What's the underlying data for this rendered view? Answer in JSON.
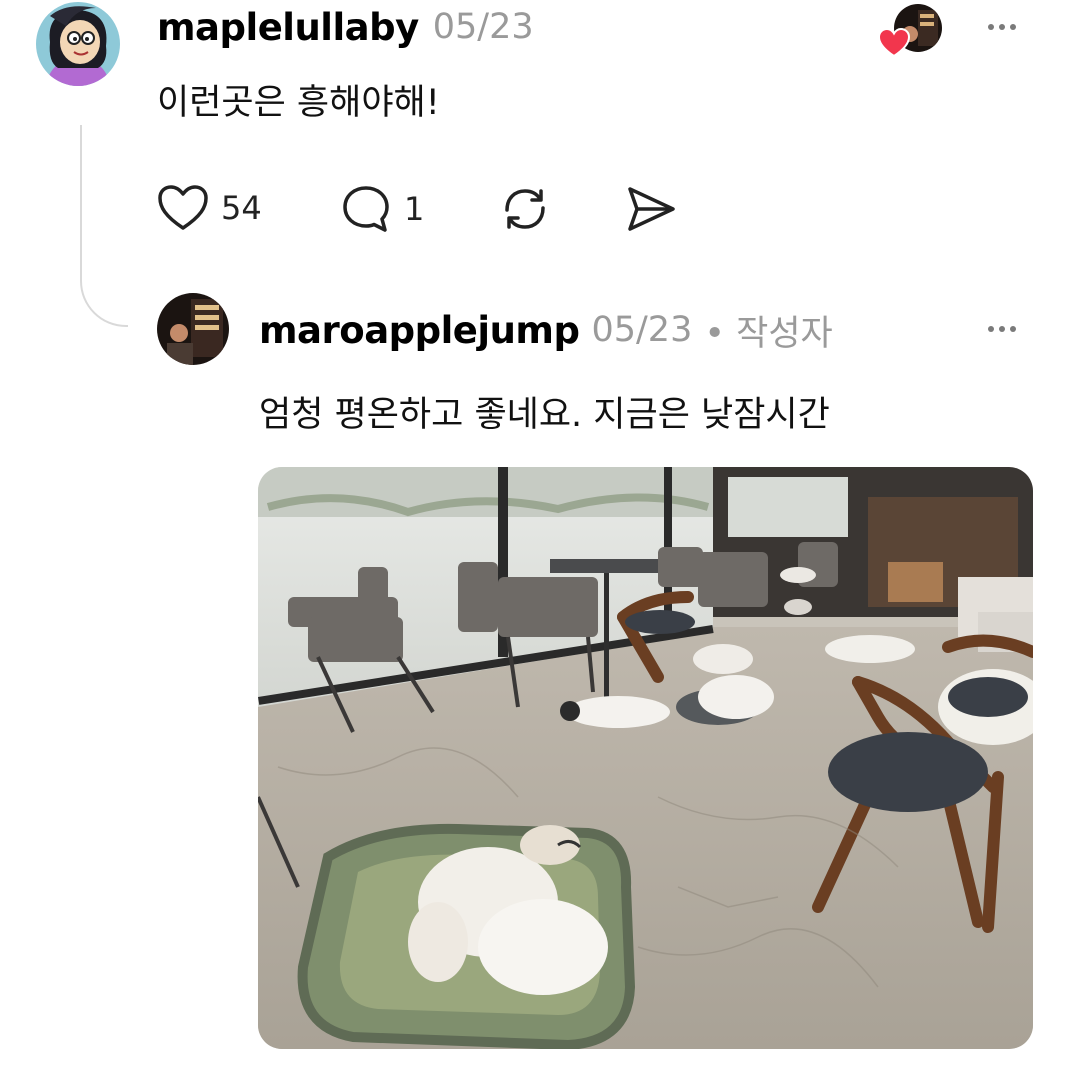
{
  "post": {
    "username": "maplelullaby",
    "date": "05/23",
    "text": "이런곳은 흥해야해!",
    "likes": "54",
    "replies": "1",
    "icons": [
      "heart-icon",
      "comment-icon",
      "repost-icon",
      "share-icon",
      "more-icon"
    ]
  },
  "reply": {
    "username": "maroapplejump",
    "date": "05/23",
    "author_tag": "• 작성자",
    "text": "엄청 평온하고 좋네요. 지금은 낮잠시간",
    "photo_alt": "Dogs napping on the floor of a cafe with chairs and tables"
  },
  "colors": {
    "like_heart": "#f2364d",
    "muted_text": "#9a9a9a",
    "thread_line": "#d9d9d9"
  }
}
